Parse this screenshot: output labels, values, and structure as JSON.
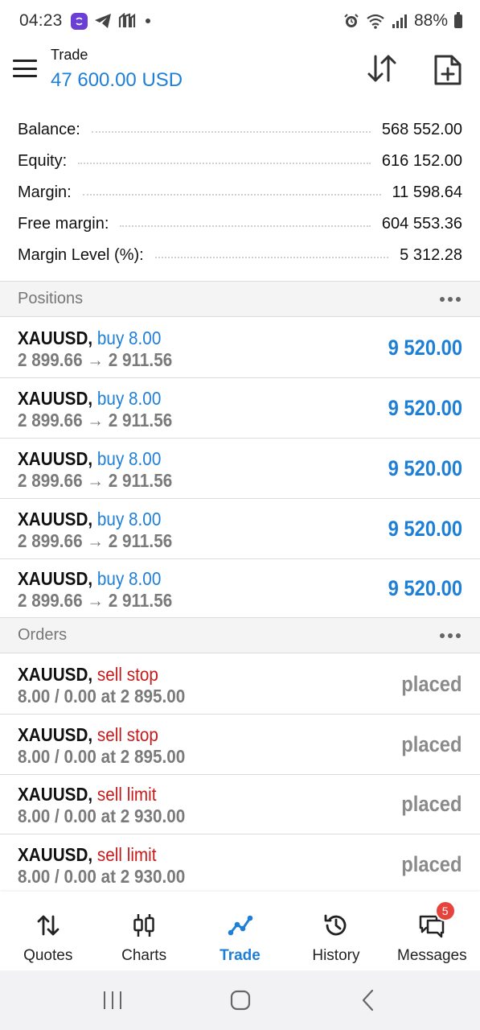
{
  "status_bar": {
    "time": "04:23",
    "battery": "88%",
    "left_icons": [
      "viber-icon",
      "telegram-icon",
      "app-icon"
    ],
    "right_icons": [
      "alarm-icon",
      "wifi-icon",
      "signal-icon",
      "battery-icon"
    ]
  },
  "header": {
    "title": "Trade",
    "balance": "47 600.00 USD",
    "icons": [
      "menu-icon",
      "sort-icon",
      "new-order-icon"
    ]
  },
  "summary": {
    "rows": [
      {
        "label": "Balance:",
        "value": "568 552.00"
      },
      {
        "label": "Equity:",
        "value": "616 152.00"
      },
      {
        "label": "Margin:",
        "value": "11 598.64"
      },
      {
        "label": "Free margin:",
        "value": "604 553.36"
      },
      {
        "label": "Margin Level (%):",
        "value": "5 312.28"
      }
    ]
  },
  "positions": {
    "title": "Positions",
    "items": [
      {
        "symbol": "XAUUSD,",
        "type": "buy 8.00",
        "prices": "2 899.66 → 2 911.56",
        "profit": "9 520.00"
      },
      {
        "symbol": "XAUUSD,",
        "type": "buy 8.00",
        "prices": "2 899.66 → 2 911.56",
        "profit": "9 520.00"
      },
      {
        "symbol": "XAUUSD,",
        "type": "buy 8.00",
        "prices": "2 899.66 → 2 911.56",
        "profit": "9 520.00"
      },
      {
        "symbol": "XAUUSD,",
        "type": "buy 8.00",
        "prices": "2 899.66 → 2 911.56",
        "profit": "9 520.00"
      },
      {
        "symbol": "XAUUSD,",
        "type": "buy 8.00",
        "prices": "2 899.66 → 2 911.56",
        "profit": "9 520.00"
      }
    ]
  },
  "orders": {
    "title": "Orders",
    "items": [
      {
        "symbol": "XAUUSD,",
        "type": "sell stop",
        "details": "8.00 / 0.00 at 2 895.00",
        "status": "placed"
      },
      {
        "symbol": "XAUUSD,",
        "type": "sell stop",
        "details": "8.00 / 0.00 at 2 895.00",
        "status": "placed"
      },
      {
        "symbol": "XAUUSD,",
        "type": "sell limit",
        "details": "8.00 / 0.00 at 2 930.00",
        "status": "placed"
      },
      {
        "symbol": "XAUUSD,",
        "type": "sell limit",
        "details": "8.00 / 0.00 at 2 930.00",
        "status": "placed"
      }
    ]
  },
  "bottom_nav": {
    "items": [
      {
        "label": "Quotes",
        "icon": "quotes-icon"
      },
      {
        "label": "Charts",
        "icon": "charts-icon"
      },
      {
        "label": "Trade",
        "icon": "trade-icon",
        "active": true
      },
      {
        "label": "History",
        "icon": "history-icon"
      },
      {
        "label": "Messages",
        "icon": "messages-icon",
        "badge": "5"
      }
    ]
  },
  "colors": {
    "accent": "#1e7fd6",
    "sell": "#c81a1a",
    "muted": "#7a7a7a",
    "badge": "#e5433b"
  }
}
